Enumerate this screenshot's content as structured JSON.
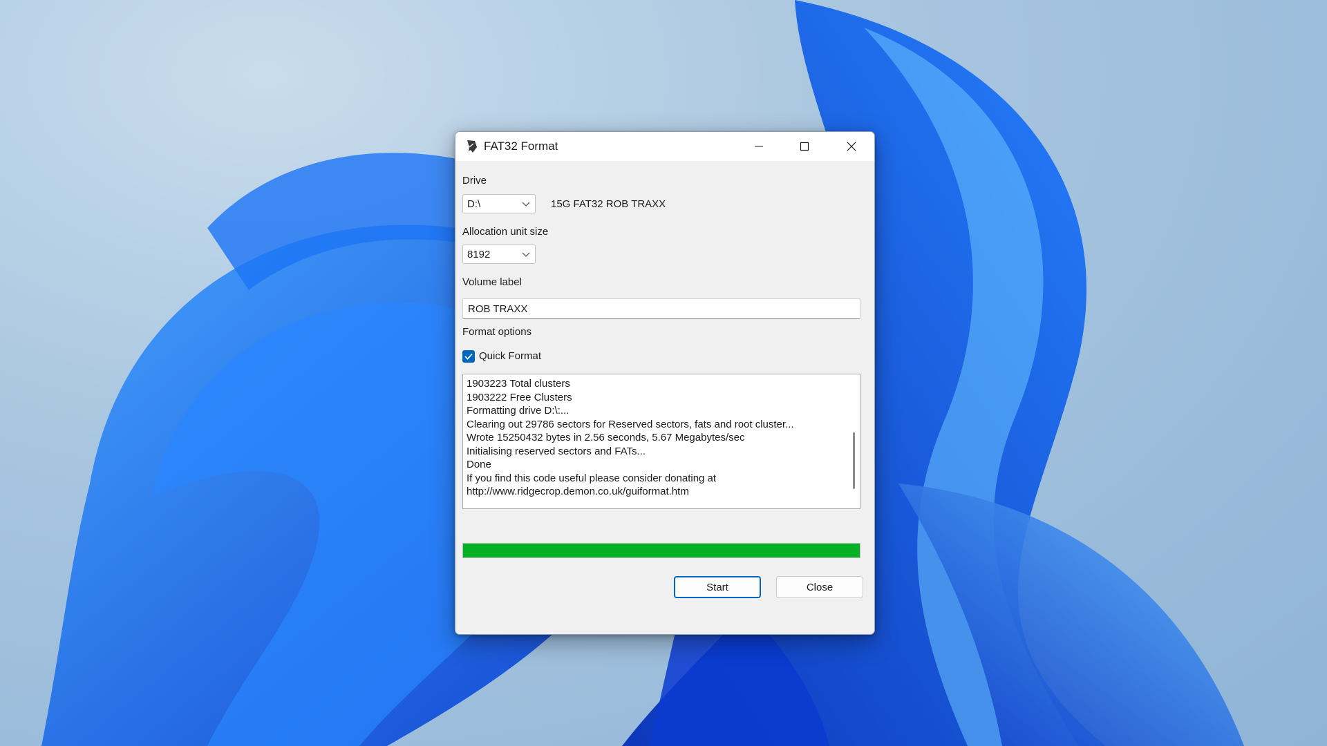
{
  "window": {
    "title": "FAT32 Format",
    "icon": "feather-icon"
  },
  "drive": {
    "label": "Drive",
    "selected": "D:\\",
    "description": "15G FAT32 ROB TRAXX"
  },
  "allocation": {
    "label": "Allocation unit size",
    "selected": "8192"
  },
  "volume": {
    "label": "Volume label",
    "value": "ROB TRAXX"
  },
  "format_options": {
    "label": "Format options",
    "quick_format_label": "Quick Format",
    "quick_format_checked": true
  },
  "log": {
    "lines": [
      "1903223 Total clusters",
      "1903222 Free Clusters",
      "Formatting drive D:\\:...",
      "Clearing out 29786 sectors for Reserved sectors, fats and root cluster...",
      "Wrote 15250432 bytes in 2.56 seconds, 5.67 Megabytes/sec",
      "Initialising reserved sectors and FATs...",
      "Done",
      "If you find this code useful please consider donating at",
      "http://www.ridgecrop.demon.co.uk/guiformat.htm"
    ]
  },
  "progress": {
    "fraction": 1.0,
    "color": "#06b025"
  },
  "buttons": {
    "start": "Start",
    "close": "Close"
  }
}
